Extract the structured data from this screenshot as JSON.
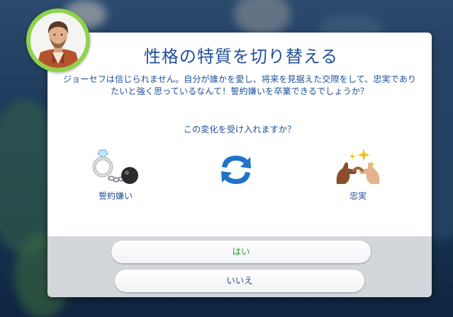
{
  "dialog": {
    "title": "性格の特質を切り替える",
    "message": "ジョーセフは信じられません。自分が誰かを愛し、将来を見据えた交際をして、忠実でありたいと強く思っているなんて！誓約嫌いを卒業できるでしょうか？",
    "prompt": "この変化を受け入れますか？",
    "from_trait": {
      "label": "誓約嫌い",
      "icon": "ring-ball-and-chain-icon"
    },
    "to_trait": {
      "label": "忠実",
      "icon": "pinky-promise-icon"
    },
    "swap_icon": "swap-arrows-icon",
    "avatar_icon": "sim-portrait-icon"
  },
  "buttons": {
    "yes_label": "はい",
    "no_label": "いいえ"
  },
  "colors": {
    "text_blue": "#1f4f9a",
    "yes_green": "#2d9a2f",
    "avatar_ring": "#8fd24b",
    "footer_gray": "#d3d6db",
    "swap_blue": "#1f73c9"
  }
}
